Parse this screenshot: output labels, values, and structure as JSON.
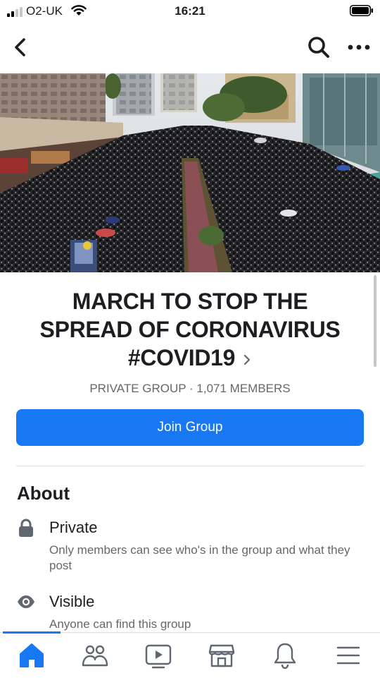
{
  "status_bar": {
    "carrier": "O2-UK",
    "time": "16:21"
  },
  "nav": {
    "back_icon": "chevron-left-icon",
    "search_icon": "search-icon",
    "more_icon": "more-dots-icon"
  },
  "cover": {
    "icon": "crowd-protest-photo"
  },
  "group": {
    "title_line1": "MARCH TO STOP THE",
    "title_line2": "SPREAD OF CORONAVIRUS",
    "title_line3": "#COVID19",
    "meta": "PRIVATE GROUP · 1,071 MEMBERS",
    "join_label": "Join Group"
  },
  "about": {
    "heading": "About",
    "items": [
      {
        "icon": "lock-icon",
        "title": "Private",
        "description": "Only members can see who's in the group and what they post"
      },
      {
        "icon": "eye-icon",
        "title": "Visible",
        "description": "Anyone can find this group"
      }
    ]
  },
  "tab_bar": {
    "tabs": [
      "home-icon",
      "groups-icon",
      "watch-icon",
      "marketplace-icon",
      "notifications-icon",
      "menu-icon"
    ],
    "active": "home-icon"
  },
  "colors": {
    "accent": "#1877f2",
    "secondary_text": "#65676b",
    "icon_gray": "#606770",
    "divider": "#dadde1"
  }
}
